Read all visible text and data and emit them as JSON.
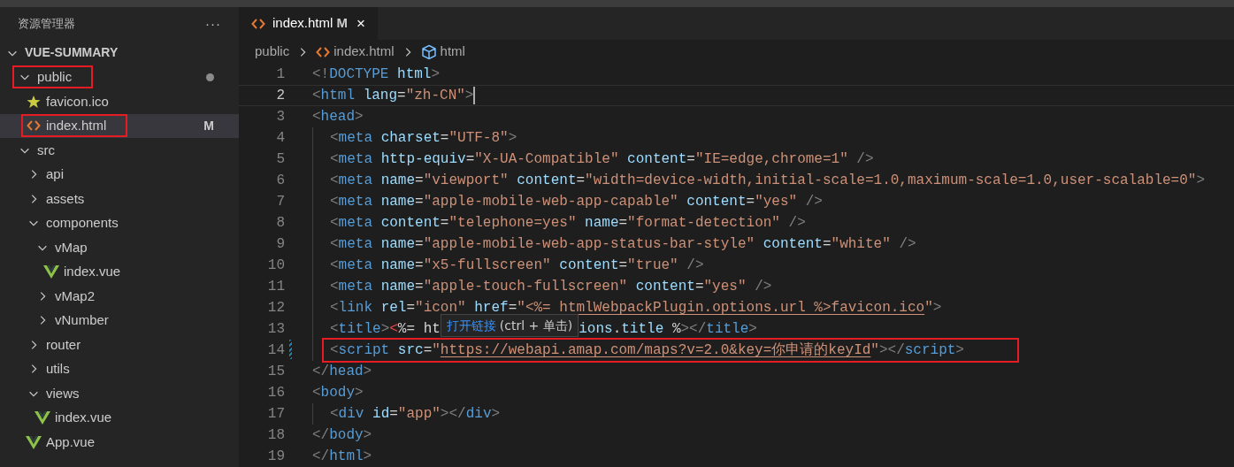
{
  "sidebar": {
    "title": "资源管理器",
    "more": "···",
    "root": {
      "label": "VUE-SUMMARY",
      "expanded": true
    },
    "tree": [
      {
        "label": "public",
        "kind": "folder",
        "expanded": true,
        "selected": false,
        "highlighted": true,
        "modified_dot": true,
        "children": [
          {
            "label": "favicon.ico",
            "kind": "star",
            "selected": false
          },
          {
            "label": "index.html",
            "kind": "html",
            "selected": true,
            "highlighted": true,
            "badge": "M"
          }
        ]
      },
      {
        "label": "src",
        "kind": "folder",
        "expanded": true,
        "selected": false,
        "children": [
          {
            "label": "api",
            "kind": "folder",
            "expanded": false,
            "selected": false
          },
          {
            "label": "assets",
            "kind": "folder",
            "expanded": false,
            "selected": false
          },
          {
            "label": "components",
            "kind": "folder",
            "expanded": true,
            "selected": false,
            "children": [
              {
                "label": "vMap",
                "kind": "folder",
                "expanded": true,
                "selected": false,
                "children": [
                  {
                    "label": "index.vue",
                    "kind": "vue",
                    "selected": false
                  }
                ]
              },
              {
                "label": "vMap2",
                "kind": "folder",
                "expanded": false,
                "selected": false
              },
              {
                "label": "vNumber",
                "kind": "folder",
                "expanded": false,
                "selected": false
              }
            ]
          },
          {
            "label": "router",
            "kind": "folder",
            "expanded": false,
            "selected": false
          },
          {
            "label": "utils",
            "kind": "folder",
            "expanded": false,
            "selected": false
          },
          {
            "label": "views",
            "kind": "folder",
            "expanded": true,
            "selected": false,
            "children": [
              {
                "label": "index.vue",
                "kind": "vue",
                "selected": false
              }
            ]
          },
          {
            "label": "App.vue",
            "kind": "vue",
            "selected": false
          }
        ]
      }
    ]
  },
  "tabs": [
    {
      "label": "index.html",
      "badge": "M",
      "close": "×",
      "selected": true
    }
  ],
  "breadcrumb": [
    {
      "label": "public",
      "kind": "folder"
    },
    {
      "label": "index.html",
      "kind": "html"
    },
    {
      "label": "html",
      "kind": "element"
    }
  ],
  "code": [
    {
      "number": "1",
      "current": false,
      "text": "<!DOCTYPE html>"
    },
    {
      "number": "2",
      "current": true,
      "text": "<html lang=\"zh-CN\">"
    },
    {
      "number": "3",
      "current": false,
      "text": "<head>"
    },
    {
      "number": "4",
      "current": false,
      "indented": true,
      "text": "<meta charset=\"UTF-8\">"
    },
    {
      "number": "5",
      "current": false,
      "indented": true,
      "text": "<meta http-equiv=\"X-UA-Compatible\" content=\"IE=edge,chrome=1\" />"
    },
    {
      "number": "6",
      "current": false,
      "indented": true,
      "text": "<meta name=\"viewport\" content=\"width=device-width,initial-scale=1.0,maximum-scale=1.0,user-scalable=0\">"
    },
    {
      "number": "7",
      "current": false,
      "indented": true,
      "text": "<meta name=\"apple-mobile-web-app-capable\" content=\"yes\" />"
    },
    {
      "number": "8",
      "current": false,
      "indented": true,
      "text": "<meta content=\"telephone=yes\" name=\"format-detection\" />"
    },
    {
      "number": "9",
      "current": false,
      "indented": true,
      "text": "<meta name=\"apple-mobile-web-app-status-bar-style\" content=\"white\" />"
    },
    {
      "number": "10",
      "current": false,
      "indented": true,
      "text": "<meta name=\"x5-fullscreen\" content=\"true\" />"
    },
    {
      "number": "11",
      "current": false,
      "indented": true,
      "text": "<meta name=\"apple-touch-fullscreen\" content=\"yes\" />"
    },
    {
      "number": "12",
      "current": false,
      "indented": true,
      "text": "<link rel=\"icon\" href=\"<%= htmlWebpackPlugin.options.url %>favicon.ico\">"
    },
    {
      "number": "13",
      "current": false,
      "indented": true,
      "text": "<title><%= ht",
      "tooltip": {
        "link": "打开链接",
        "hint": "(ctrl + 单击)"
      },
      "text_after": "ions.title %></title>"
    },
    {
      "number": "14",
      "current": false,
      "indented": true,
      "changed": true,
      "highlighted": true,
      "text": "<script src=\"https://webapi.amap.com/maps?v=2.0&key=你申请的keyId\"></script>"
    },
    {
      "number": "15",
      "current": false,
      "text": "</head>"
    },
    {
      "number": "16",
      "current": false,
      "text": "<body>"
    },
    {
      "number": "17",
      "current": false,
      "indented": true,
      "text": "<div id=\"app\"></div>"
    },
    {
      "number": "18",
      "current": false,
      "text": "</body>"
    },
    {
      "number": "19",
      "current": false,
      "text": "</html>"
    }
  ]
}
